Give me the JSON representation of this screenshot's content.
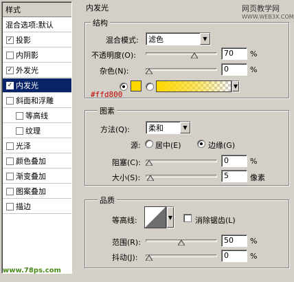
{
  "style_list": {
    "header": "样式",
    "items": [
      {
        "label": "混合选项:默认",
        "has_checkbox": false,
        "checked": false,
        "sub": false,
        "selected": false
      },
      {
        "label": "投影",
        "has_checkbox": true,
        "checked": true,
        "sub": false,
        "selected": false
      },
      {
        "label": "内阴影",
        "has_checkbox": true,
        "checked": false,
        "sub": false,
        "selected": false
      },
      {
        "label": "外发光",
        "has_checkbox": true,
        "checked": true,
        "sub": false,
        "selected": false
      },
      {
        "label": "内发光",
        "has_checkbox": true,
        "checked": true,
        "sub": false,
        "selected": true
      },
      {
        "label": "斜面和浮雕",
        "has_checkbox": true,
        "checked": false,
        "sub": false,
        "selected": false
      },
      {
        "label": "等高线",
        "has_checkbox": true,
        "checked": false,
        "sub": true,
        "selected": false
      },
      {
        "label": "纹理",
        "has_checkbox": true,
        "checked": false,
        "sub": true,
        "selected": false
      },
      {
        "label": "光泽",
        "has_checkbox": true,
        "checked": false,
        "sub": false,
        "selected": false
      },
      {
        "label": "颜色叠加",
        "has_checkbox": true,
        "checked": false,
        "sub": false,
        "selected": false
      },
      {
        "label": "渐变叠加",
        "has_checkbox": true,
        "checked": false,
        "sub": false,
        "selected": false
      },
      {
        "label": "图案叠加",
        "has_checkbox": true,
        "checked": false,
        "sub": false,
        "selected": false
      },
      {
        "label": "描边",
        "has_checkbox": true,
        "checked": false,
        "sub": false,
        "selected": false
      }
    ],
    "check_glyph": "✓",
    "logo_text": "www.78ps.com"
  },
  "panel": {
    "title": "内发光",
    "watermark": "网页教学网",
    "watermark_url": "WWW.WEB3X.COM",
    "structure": {
      "legend": "结构",
      "blend_mode_label": "混合模式:",
      "blend_mode_value": "滤色",
      "opacity_label": "不透明度(O):",
      "opacity_value": "70",
      "opacity_unit": "%",
      "opacity_level": 0.7,
      "noise_label": "杂色(N):",
      "noise_value": "0",
      "noise_unit": "%",
      "noise_level": 0,
      "color_hex": "#ffd800",
      "color_radio_selected": true,
      "gradient_radio_selected": false
    },
    "elements": {
      "legend": "图素",
      "technique_label": "方法(Q):",
      "technique_value": "柔和",
      "source_label": "源:",
      "source_center": "居中(E)",
      "source_edge": "边缘(G)",
      "source_selected": "edge",
      "choke_label": "阻塞(C):",
      "choke_value": "0",
      "choke_unit": "%",
      "choke_level": 0,
      "size_label": "大小(S):",
      "size_value": "5",
      "size_unit": "像素",
      "size_level": 0.02
    },
    "quality": {
      "legend": "品质",
      "contour_label": "等高线:",
      "antialias_label": "消除锯齿(L)",
      "antialias_checked": false,
      "range_label": "范围(R):",
      "range_value": "50",
      "range_unit": "%",
      "range_level": 0.5,
      "jitter_label": "抖动(J):",
      "jitter_value": "0",
      "jitter_unit": "%",
      "jitter_level": 0
    }
  },
  "colors": {
    "selection_bg": "#0a246a",
    "dialog_bg": "#d4d0c8",
    "glow_color": "#ffd800",
    "hex_text": "#c00000"
  }
}
